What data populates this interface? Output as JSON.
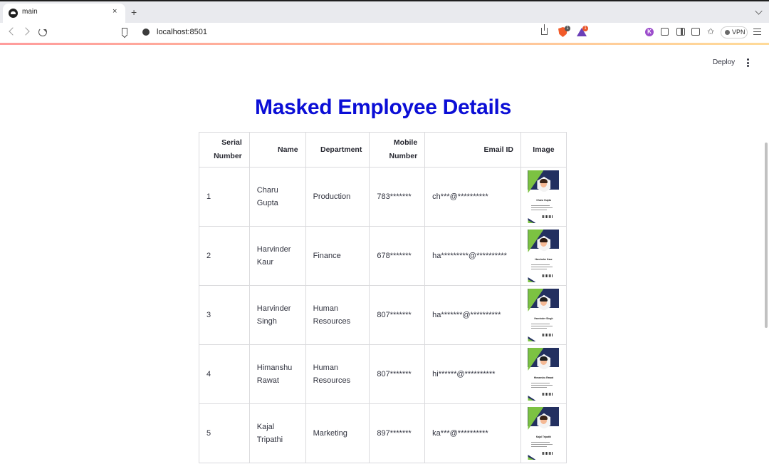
{
  "browser": {
    "tab_title": "main",
    "new_tab_symbol": "+",
    "close_symbol": "×",
    "url": "localhost:8501",
    "extension_k_label": "K",
    "vpn_label": "VPN",
    "brave_badge": "1",
    "rewards_badge": "1",
    "leo_glyph": "✩"
  },
  "app": {
    "deploy_label": "Deploy",
    "title": "Masked Employee Details",
    "title_color": "#0b0ed6",
    "accent_color": "#ff4b4b"
  },
  "table": {
    "columns": [
      "Serial Number",
      "Name",
      "Department",
      "Mobile Number",
      "Email ID",
      "Image"
    ],
    "rows": [
      {
        "serial": "1",
        "name": "Charu Gupta",
        "department": "Production",
        "mobile": "783*******",
        "email": "ch***@**********",
        "card_name": "Charu Gupta",
        "hair": "#3a2418"
      },
      {
        "serial": "2",
        "name": "Harvinder Kaur",
        "department": "Finance",
        "mobile": "678*******",
        "email": "ha*********@**********",
        "card_name": "Harvinder Kaur",
        "hair": "#2b1a12"
      },
      {
        "serial": "3",
        "name": "Harvinder Singh",
        "department": "Human Resources",
        "mobile": "807*******",
        "email": "ha*******@**********",
        "card_name": "Harvinder Singh",
        "hair": "#1f1f1f"
      },
      {
        "serial": "4",
        "name": "Himanshu Rawat",
        "department": "Human Resources",
        "mobile": "807*******",
        "email": "hi******@**********",
        "card_name": "Himanshu Rawat",
        "hair": "#1f1f1f"
      },
      {
        "serial": "5",
        "name": "Kajal Tripathi",
        "department": "Marketing",
        "mobile": "897*******",
        "email": "ka***@**********",
        "card_name": "Kajal Tripathi",
        "hair": "#3a2418"
      }
    ]
  }
}
